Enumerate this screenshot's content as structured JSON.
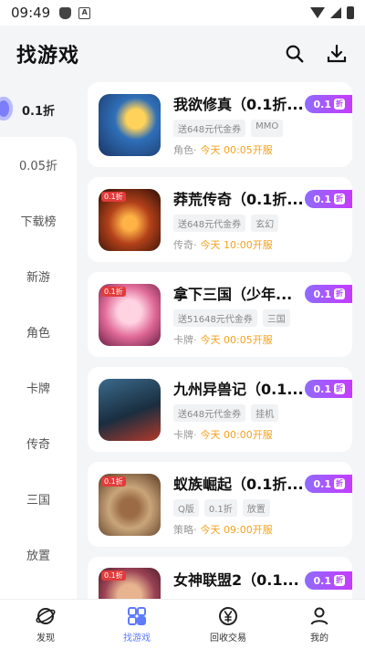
{
  "status_bar": {
    "time": "09:49"
  },
  "header": {
    "title": "找游戏"
  },
  "sidebar": {
    "active": "0.1折",
    "items": [
      "0.05折",
      "下载榜",
      "新游",
      "角色",
      "卡牌",
      "传奇",
      "三国",
      "放置"
    ]
  },
  "games": [
    {
      "title": "我欲修真（0.1折...",
      "tags": [
        "送648元代金券",
        "MMO"
      ],
      "genre": "角色",
      "open": "今天 00:05开服",
      "discount": "0.1",
      "discount_suffix": "折",
      "icon": "game-icon-wuxia",
      "colors": [
        "#2f6fb8",
        "#c9a24a"
      ]
    },
    {
      "title": "莽荒传奇（0.1折...",
      "tags": [
        "送648元代金券",
        "玄幻"
      ],
      "genre": "传奇",
      "open": "今天 10:00开服",
      "discount": "0.1",
      "discount_suffix": "折",
      "icon": "game-icon-fire",
      "colors": [
        "#4a1b0c",
        "#f08a2a"
      ],
      "badge": "0.1折"
    },
    {
      "title": "拿下三国（少年...",
      "tags": [
        "送51648元代金券",
        "三国"
      ],
      "genre": "卡牌",
      "open": "今天 00:05开服",
      "discount": "0.1",
      "discount_suffix": "折",
      "icon": "game-icon-anime",
      "colors": [
        "#f4a1c0",
        "#8a2d5a"
      ],
      "badge": "0.1折"
    },
    {
      "title": "九州异兽记（0.1...",
      "tags": [
        "送648元代金券",
        "挂机"
      ],
      "genre": "卡牌",
      "open": "今天 00:00开服",
      "discount": "0.1",
      "discount_suffix": "折",
      "icon": "game-icon-beast",
      "colors": [
        "#1f3b52",
        "#c23c2c"
      ]
    },
    {
      "title": "蚁族崛起（0.1折...",
      "tags": [
        "Q版",
        "0.1折",
        "放置"
      ],
      "genre": "策略",
      "open": "今天 09:00开服",
      "discount": "0.1",
      "discount_suffix": "折",
      "icon": "game-icon-ant",
      "colors": [
        "#5a3a22",
        "#c9a57a"
      ],
      "badge": "0.1折"
    },
    {
      "title": "女神联盟2（0.1...",
      "tags": [
        "",
        ""
      ],
      "genre": "",
      "open": "",
      "discount": "0.1",
      "discount_suffix": "折",
      "icon": "game-icon-goddess",
      "colors": [
        "#6a2b3c",
        "#d7a07a"
      ],
      "badge": "0.1折"
    }
  ],
  "bottom_nav": [
    {
      "label": "发现",
      "icon": "planet-icon"
    },
    {
      "label": "找游戏",
      "icon": "grid-icon",
      "active": true
    },
    {
      "label": "回收交易",
      "icon": "yuan-icon"
    },
    {
      "label": "我的",
      "icon": "person-icon"
    }
  ]
}
